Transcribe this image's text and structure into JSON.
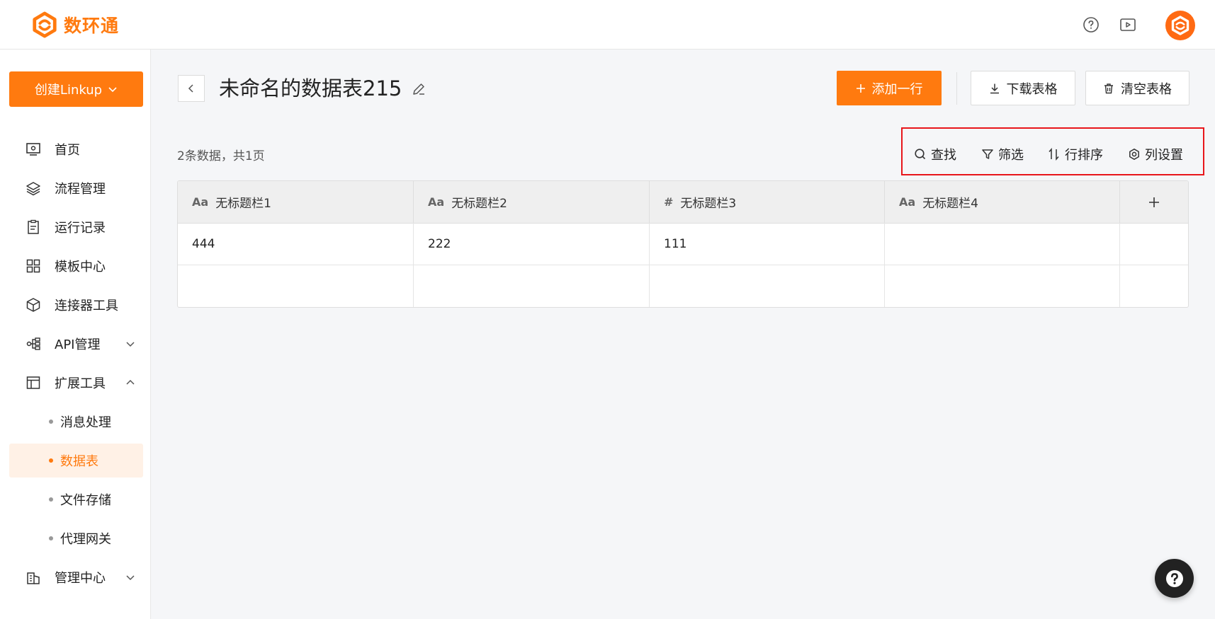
{
  "brand": {
    "name": "数环通",
    "accent": "#ff7a0f"
  },
  "header_icons": [
    "help-circle-icon",
    "video-icon",
    "avatar"
  ],
  "sidebar": {
    "create_label": "创建Linkup",
    "items": [
      {
        "label": "首页",
        "icon": "monitor-icon"
      },
      {
        "label": "流程管理",
        "icon": "layers-icon"
      },
      {
        "label": "运行记录",
        "icon": "clipboard-icon"
      },
      {
        "label": "模板中心",
        "icon": "grid-icon"
      },
      {
        "label": "连接器工具",
        "icon": "cube-icon"
      },
      {
        "label": "API管理",
        "icon": "network-icon",
        "expanded": false
      },
      {
        "label": "扩展工具",
        "icon": "layout-icon",
        "expanded": true
      },
      {
        "label": "管理中心",
        "icon": "building-icon",
        "expanded": false
      }
    ],
    "sub_items": [
      {
        "label": "消息处理",
        "active": false
      },
      {
        "label": "数据表",
        "active": true
      },
      {
        "label": "文件存储",
        "active": false
      },
      {
        "label": "代理网关",
        "active": false
      }
    ]
  },
  "page": {
    "title": "未命名的数据表215",
    "add_row": "添加一行",
    "download": "下载表格",
    "clear": "清空表格",
    "summary": "2条数据，共1页"
  },
  "toolbar": {
    "search": "查找",
    "filter": "筛选",
    "sort": "行排序",
    "columns": "列设置"
  },
  "table": {
    "columns": [
      {
        "type": "Aa",
        "name": "无标题栏1"
      },
      {
        "type": "Aa",
        "name": "无标题栏2"
      },
      {
        "type": "#",
        "name": "无标题栏3"
      },
      {
        "type": "Aa",
        "name": "无标题栏4"
      }
    ],
    "rows": [
      [
        "444",
        "222",
        "111",
        ""
      ],
      [
        "",
        "",
        "",
        ""
      ]
    ]
  }
}
